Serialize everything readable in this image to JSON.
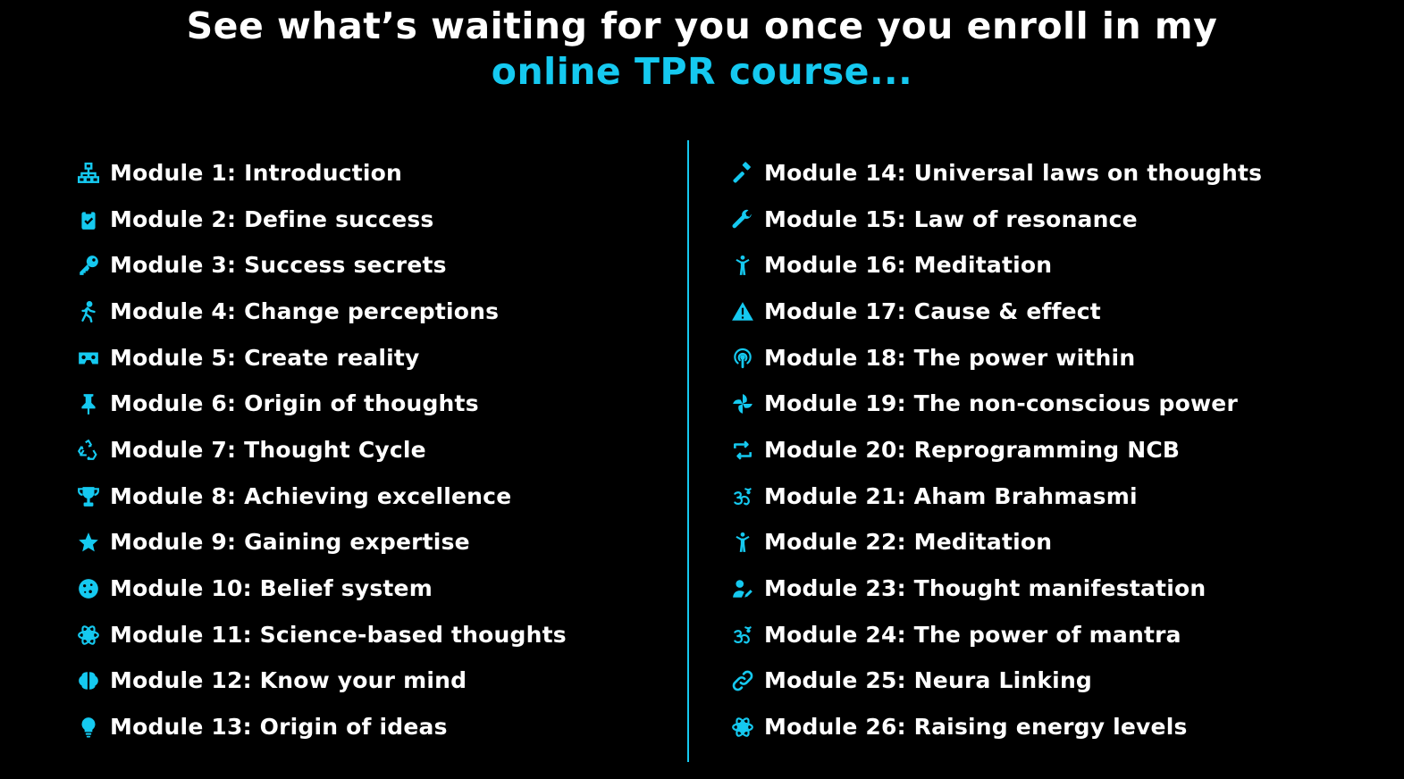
{
  "headline": {
    "line1": "See what’s waiting for you once you enroll in my",
    "line2": "online TPR course..."
  },
  "colors": {
    "background": "#000000",
    "accent": "#15c9f0",
    "text": "#ffffff"
  },
  "modules_left": [
    {
      "label": "Module 1: Introduction",
      "icon": "sitemap-icon"
    },
    {
      "label": "Module 2: Define success",
      "icon": "clipboard-check-icon"
    },
    {
      "label": "Module 3: Success secrets",
      "icon": "key-icon"
    },
    {
      "label": "Module 4: Change perceptions",
      "icon": "walking-icon"
    },
    {
      "label": "Module 5: Create reality",
      "icon": "vr-headset-icon"
    },
    {
      "label": "Module 6: Origin of thoughts",
      "icon": "thumbtack-icon"
    },
    {
      "label": "Module 7: Thought Cycle",
      "icon": "recycle-icon"
    },
    {
      "label": "Module 8: Achieving excellence",
      "icon": "trophy-icon"
    },
    {
      "label": "Module 9: Gaining expertise",
      "icon": "star-icon"
    },
    {
      "label": "Module 10: Belief system",
      "icon": "cookie-icon"
    },
    {
      "label": "Module 11: Science-based thoughts",
      "icon": "atom-gear-icon"
    },
    {
      "label": "Module 12: Know your mind",
      "icon": "brain-icon"
    },
    {
      "label": "Module 13: Origin of ideas",
      "icon": "lightbulb-icon"
    }
  ],
  "modules_right": [
    {
      "label": "Module 14: Universal laws on thoughts",
      "icon": "gavel-icon"
    },
    {
      "label": "Module 15: Law of resonance",
      "icon": "wrench-icon"
    },
    {
      "label": "Module 16: Meditation",
      "icon": "meditation-person-icon"
    },
    {
      "label": "Module 17: Cause & effect",
      "icon": "warning-icon"
    },
    {
      "label": "Module 18: The power within",
      "icon": "podcast-icon"
    },
    {
      "label": "Module 19: The non-conscious power",
      "icon": "pinwheel-icon"
    },
    {
      "label": "Module 20: Reprogramming NCB",
      "icon": "retweet-icon"
    },
    {
      "label": "Module 21: Aham Brahmasmi",
      "icon": "om-icon"
    },
    {
      "label": "Module 22: Meditation",
      "icon": "meditation-person-icon"
    },
    {
      "label": "Module 23: Thought manifestation",
      "icon": "user-edit-icon"
    },
    {
      "label": "Module 24: The power of mantra",
      "icon": "om-icon"
    },
    {
      "label": "Module 25: Neura Linking",
      "icon": "link-icon"
    },
    {
      "label": "Module 26: Raising energy levels",
      "icon": "atom-gear-icon"
    }
  ]
}
